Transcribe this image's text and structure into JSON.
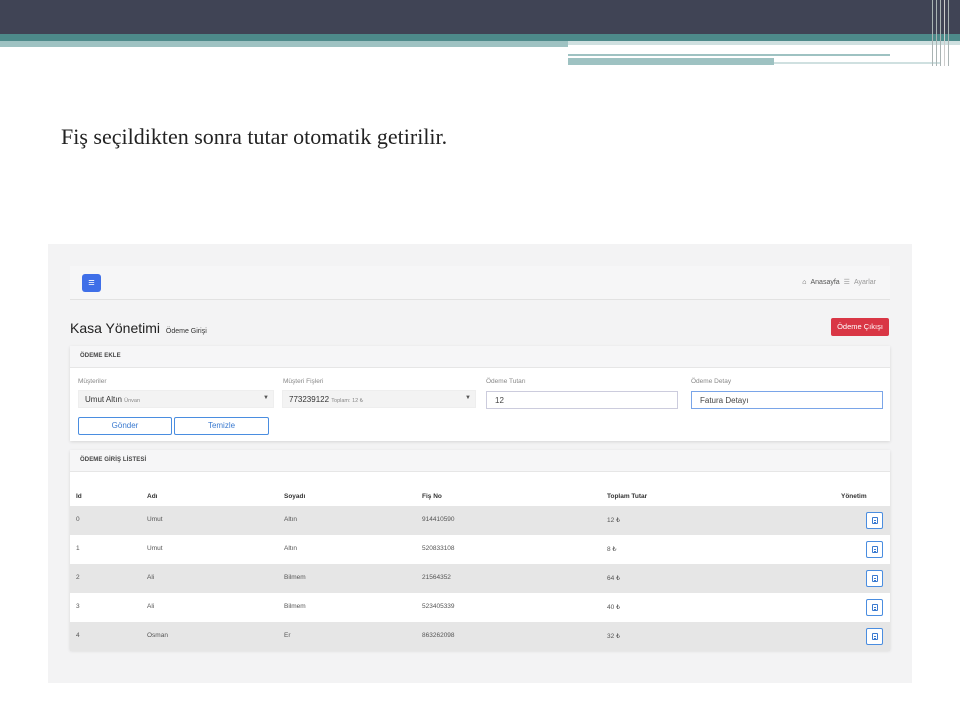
{
  "slide": {
    "title": "Fiş seçildikten sonra tutar otomatik getirilir."
  },
  "navbar": {
    "menu_icon": "menu-icon",
    "home_icon": "home-icon",
    "home_label": "Anasayfa",
    "settings_icon": "list-icon",
    "settings_label": "Ayarlar"
  },
  "page": {
    "title": "Kasa Yönetimi",
    "subtitle": "Ödeme Girişi",
    "exit_button": "Ödeme Çıkışı"
  },
  "form": {
    "header": "ÖDEME EKLE",
    "customer_label": "Müşteriler",
    "customer_value": "Umut Altın",
    "customer_hint": "Ünvan",
    "receipt_label": "Müşteri Fişleri",
    "receipt_value": "773239122",
    "receipt_hint": "Toplam: 12 ₺",
    "amount_label": "Ödeme Tutarı",
    "amount_value": "12",
    "detail_label": "Ödeme Detay",
    "detail_value": "Fatura Detayı",
    "submit_button": "Gönder",
    "clear_button": "Temizle"
  },
  "list": {
    "header": "ÖDEME GİRİŞ LİSTESİ",
    "columns": [
      "Id",
      "Adı",
      "Soyadı",
      "Fiş No",
      "Toplam Tutar",
      "Yönetim"
    ],
    "rows": [
      [
        "0",
        "Umut",
        "Altın",
        "914410590",
        "12 ₺"
      ],
      [
        "1",
        "Umut",
        "Altın",
        "520833108",
        "8 ₺"
      ],
      [
        "2",
        "Ali",
        "Bilmem",
        "21564352",
        "64 ₺"
      ],
      [
        "3",
        "Ali",
        "Bilmem",
        "523405339",
        "40 ₺"
      ],
      [
        "4",
        "Osman",
        "Er",
        "863262098",
        "32 ₺"
      ]
    ],
    "row_action_icon": "document-icon"
  },
  "colors": {
    "primary": "#3f6fe8",
    "danger": "#d93645",
    "outline": "#4a8de0",
    "header_dark": "#404455",
    "header_teal": "#4d8a8a"
  }
}
